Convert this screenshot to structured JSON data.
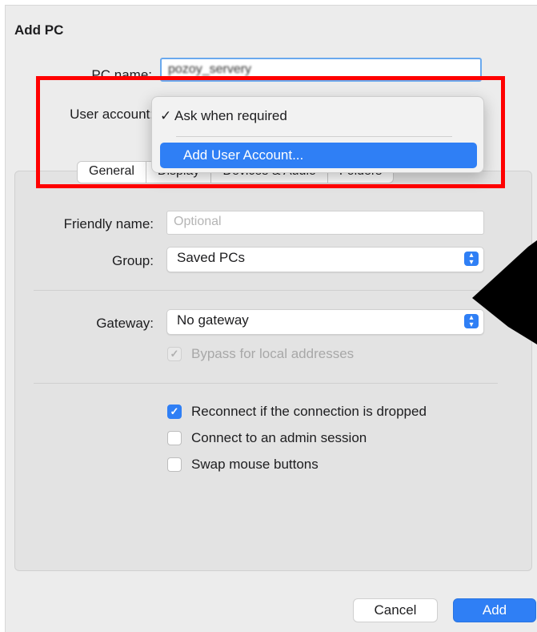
{
  "dialog": {
    "title": "Add PC",
    "pc_name_label": "PC name:",
    "pc_name_value": "pozoy_servery",
    "user_account_label": "User account:"
  },
  "dropdown": {
    "options": [
      {
        "label": "✓ Ask when required",
        "selected": true
      },
      {
        "label": "Add User Account...",
        "highlighted": true
      }
    ]
  },
  "tabs": [
    {
      "label": "General",
      "active": true
    },
    {
      "label": "Display"
    },
    {
      "label": "Devices & Audio"
    },
    {
      "label": "Folders"
    }
  ],
  "general": {
    "friendly_name_label": "Friendly name:",
    "friendly_name_placeholder": "Optional",
    "group_label": "Group:",
    "group_value": "Saved PCs",
    "gateway_label": "Gateway:",
    "gateway_value": "No gateway",
    "bypass_label": "Bypass for local addresses",
    "reconnect_label": "Reconnect if the connection is dropped",
    "admin_session_label": "Connect to an admin session",
    "swap_mouse_label": "Swap mouse buttons"
  },
  "footer": {
    "cancel_label": "Cancel",
    "add_label": "Add"
  },
  "colors": {
    "accent": "#2f7ff5",
    "annotation": "#ff0000"
  }
}
